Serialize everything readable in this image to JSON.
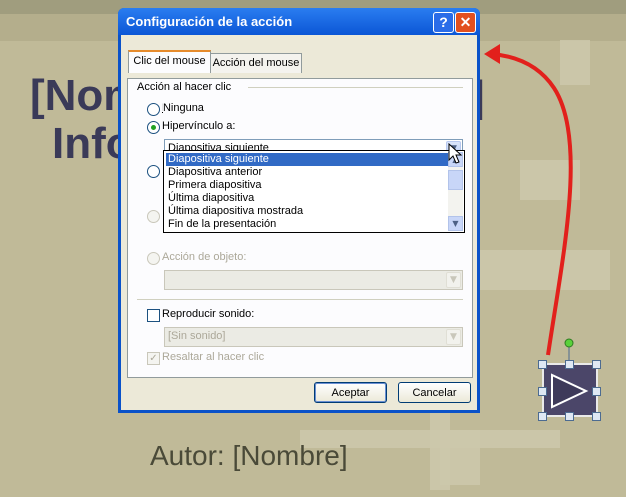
{
  "slide": {
    "title_line1": "[Nom",
    "title_line2": "Info",
    "title_right": "]",
    "author": "Autor: [Nombre]"
  },
  "dialog": {
    "title": "Configuración de la acción",
    "help_button": "?",
    "close_button": "✕",
    "tabs": [
      {
        "label": "Clic del mouse",
        "active": true
      },
      {
        "label": "Acción del mouse",
        "active": false
      }
    ],
    "group_label": "Acción al hacer clic",
    "options": {
      "none": "Ninguna",
      "hyperlink": "Hipervínculo a:",
      "object_action": "Acción de objeto:"
    },
    "selected_option": "hyperlink",
    "hyperlink_value": "Diapositiva siguiente",
    "dropdown_items": [
      "Diapositiva siguiente",
      "Diapositiva anterior",
      "Primera diapositiva",
      "Última diapositiva",
      "Última diapositiva mostrada",
      "Fin de la presentación"
    ],
    "play_sound_label": "Reproducir sonido:",
    "sound_value": "[Sin sonido]",
    "highlight_label": "Resaltar al hacer clic",
    "ok_button": "Aceptar",
    "cancel_button": "Cancelar"
  },
  "colors": {
    "arrow": "#e2201c",
    "titlebar": "#0b56d6",
    "selection": "#316ac5"
  },
  "icons": {
    "play_button": "play-triangle-icon",
    "cursor": "mouse-pointer-icon"
  }
}
